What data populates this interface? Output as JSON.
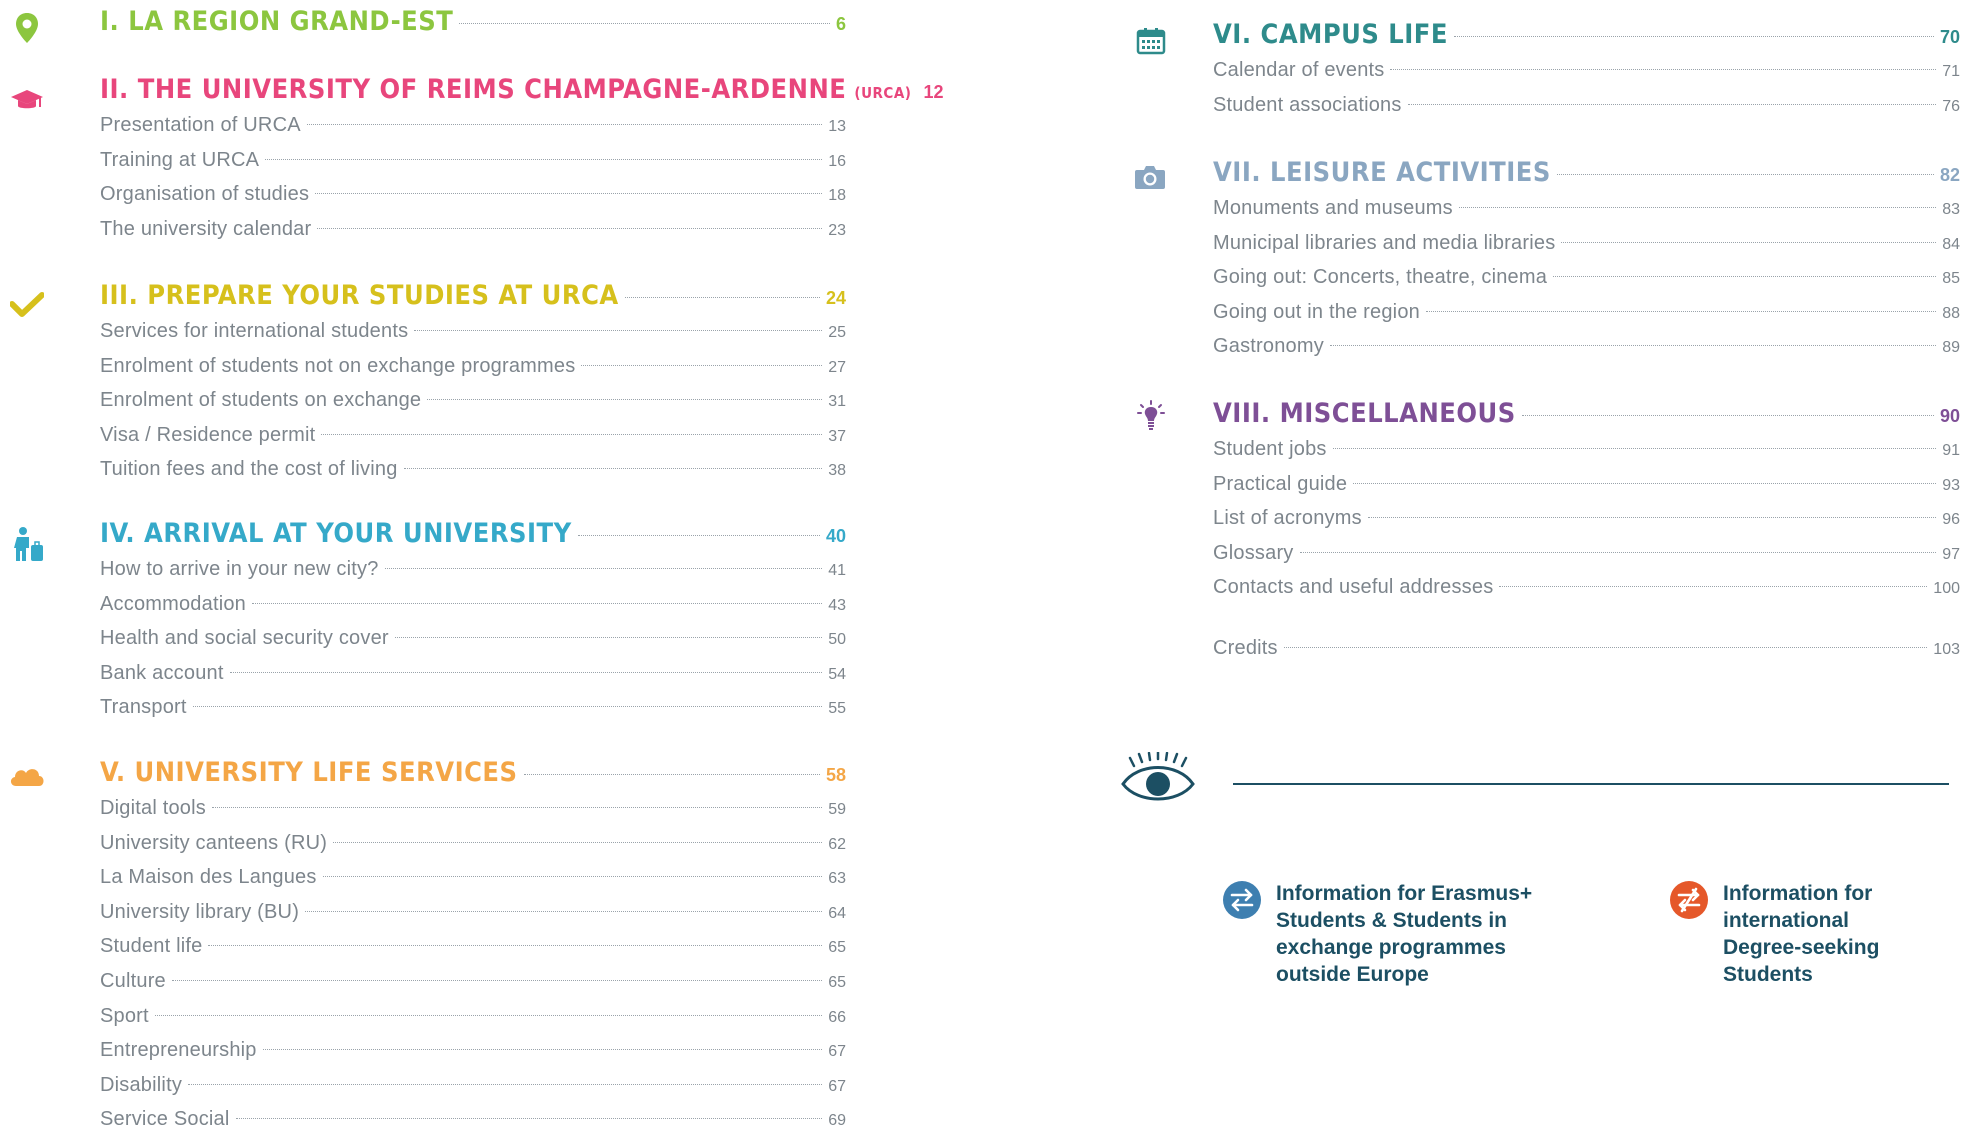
{
  "toc": {
    "left": [
      {
        "id": "s1",
        "title": "I. LA REGION GRAND-EST",
        "suffix": "",
        "page": "6",
        "color": "#8cc63f",
        "icon": "map-pin-icon",
        "items": []
      },
      {
        "id": "s2",
        "title": "II. THE UNIVERSITY OF REIMS CHAMPAGNE-ARDENNE",
        "suffix": "(URCA)",
        "page": "12",
        "color": "#e8467c",
        "icon": "graduation-cap-icon",
        "items": [
          {
            "label": "Presentation of URCA",
            "page": "13"
          },
          {
            "label": "Training at URCA",
            "page": "16"
          },
          {
            "label": "Organisation of studies",
            "page": "18"
          },
          {
            "label": "The university calendar",
            "page": "23"
          }
        ]
      },
      {
        "id": "s3",
        "title": "III.  PREPARE YOUR STUDIES AT URCA",
        "suffix": "",
        "page": "24",
        "color": "#d6c01c",
        "icon": "checkmark-icon",
        "items": [
          {
            "label": "Services for international students",
            "page": "25"
          },
          {
            "label": "Enrolment of students not on exchange programmes",
            "page": "27"
          },
          {
            "label": "Enrolment of students on exchange",
            "page": "31"
          },
          {
            "label": "Visa / Residence permit",
            "page": "37"
          },
          {
            "label": "Tuition fees and the cost of living",
            "page": "38"
          }
        ]
      },
      {
        "id": "s4",
        "title": "IV. ARRIVAL AT YOUR UNIVERSITY",
        "suffix": "",
        "page": "40",
        "color": "#35a9c9",
        "icon": "traveller-icon",
        "items": [
          {
            "label": "How to arrive in your new city?",
            "page": "41"
          },
          {
            "label": "Accommodation",
            "page": "43"
          },
          {
            "label": "Health and social security cover",
            "page": "50"
          },
          {
            "label": "Bank account",
            "page": "54"
          },
          {
            "label": "Transport",
            "page": "55"
          }
        ]
      },
      {
        "id": "s5",
        "title": "V. UNIVERSITY LIFE SERVICES",
        "suffix": "",
        "page": "58",
        "color": "#f4a646",
        "icon": "cloud-icon",
        "items": [
          {
            "label": "Digital tools",
            "page": "59"
          },
          {
            "label": "University canteens (RU)",
            "page": "62"
          },
          {
            "label": "La Maison des Langues",
            "page": "63"
          },
          {
            "label": "University library (BU)",
            "page": "64"
          },
          {
            "label": "Student life",
            "page": "65"
          },
          {
            "label": "Culture",
            "page": "65"
          },
          {
            "label": "Sport",
            "page": "66"
          },
          {
            "label": "Entrepreneurship",
            "page": "67"
          },
          {
            "label": "Disability",
            "page": "67"
          },
          {
            "label": "Service Social",
            "page": "69"
          }
        ]
      }
    ],
    "right": [
      {
        "id": "s6",
        "title": "VI. CAMPUS LIFE",
        "suffix": "",
        "page": "70",
        "color": "#2e8b8b",
        "icon": "calendar-icon",
        "items": [
          {
            "label": "Calendar of events",
            "page": "71"
          },
          {
            "label": "Student associations",
            "page": "76"
          }
        ]
      },
      {
        "id": "s7",
        "title": "VII. LEISURE ACTIVITIES",
        "suffix": "",
        "page": "82",
        "color": "#8aa6c1",
        "icon": "camera-icon",
        "items": [
          {
            "label": "Monuments and museums",
            "page": "83"
          },
          {
            "label": "Municipal libraries and media libraries",
            "page": "84"
          },
          {
            "label": "Going out: Concerts, theatre, cinema",
            "page": "85"
          },
          {
            "label": "Going out in the region",
            "page": "88"
          },
          {
            "label": "Gastronomy",
            "page": "89"
          }
        ]
      },
      {
        "id": "s8",
        "title": "VIII. MISCELLANEOUS",
        "suffix": "",
        "page": "90",
        "color": "#7e4f96",
        "icon": "lightbulb-icon",
        "items": [
          {
            "label": "Student jobs",
            "page": "91"
          },
          {
            "label": "Practical guide",
            "page": "93"
          },
          {
            "label": "List of acronyms",
            "page": "96"
          },
          {
            "label": "Glossary",
            "page": "97"
          },
          {
            "label": "Contacts and useful addresses",
            "page": "100"
          }
        ]
      }
    ],
    "credits": {
      "label": "Credits",
      "page": "103"
    }
  },
  "legend": {
    "eye_icon": "eye-icon",
    "exchange": {
      "icon": "exchange-arrows-icon",
      "color": "#3e7fb0",
      "lines": [
        "Information for Erasmus+",
        "Students & Students in",
        "exchange programmes",
        "outside Europe"
      ]
    },
    "degree": {
      "icon": "crossed-arrows-icon",
      "color": "#e5582a",
      "lines": [
        "Information for",
        "international",
        "Degree-seeking",
        "Students"
      ]
    }
  }
}
